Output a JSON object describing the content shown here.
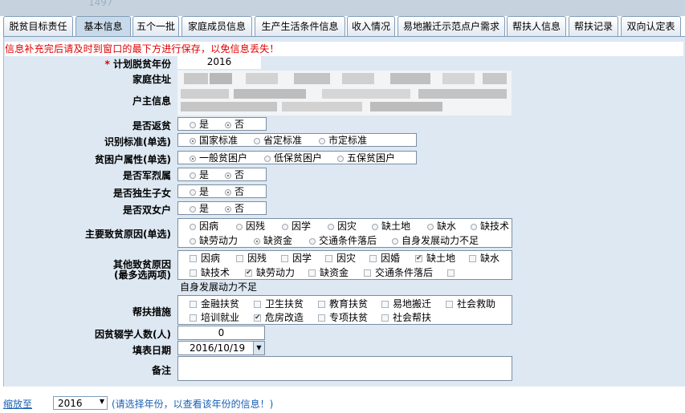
{
  "tabs": [
    {
      "label": "脱贫目标责任"
    },
    {
      "label": "基本信息"
    },
    {
      "label": "五个一批"
    },
    {
      "label": "家庭成员信息"
    },
    {
      "label": "生产生活条件信息"
    },
    {
      "label": "收入情况"
    },
    {
      "label": "易地搬迁示范点户需求"
    },
    {
      "label": "帮扶人信息"
    },
    {
      "label": "帮扶记录"
    },
    {
      "label": "双向认定表"
    }
  ],
  "top_ghost_text": "1497",
  "warning": "信息补充完后请及时到窗口的最下方进行保存，以免信息丢失！",
  "form": {
    "plan_year": {
      "required_mark": "*",
      "label": "计划脱贫年份",
      "value": "2016"
    },
    "address": {
      "label": "家庭住址"
    },
    "householder": {
      "label": "户主信息"
    },
    "return_poverty": {
      "label": "是否返贫",
      "options": [
        "是",
        "否"
      ]
    },
    "standard": {
      "label": "识别标准(单选)",
      "options": [
        "国家标准",
        "省定标准",
        "市定标准"
      ]
    },
    "attribute": {
      "label": "贫困户属性(单选)",
      "options": [
        "一般贫困户",
        "低保贫困户",
        "五保贫困户"
      ]
    },
    "martyr": {
      "label": "是否军烈属",
      "options": [
        "是",
        "否"
      ]
    },
    "only_child": {
      "label": "是否独生子女",
      "options": [
        "是",
        "否"
      ]
    },
    "two_daughters": {
      "label": "是否双女户",
      "options": [
        "是",
        "否"
      ]
    },
    "main_cause": {
      "label": "主要致贫原因(单选)",
      "row1": [
        "因病",
        "因残",
        "因学",
        "因灾",
        "缺土地",
        "缺水",
        "缺技术"
      ],
      "row2": [
        "缺劳动力",
        "缺资金",
        "交通条件落后",
        "自身发展动力不足"
      ]
    },
    "other_cause": {
      "label1": "其他致贫原因",
      "label2": "(最多选两项)",
      "row1": [
        "因病",
        "因残",
        "因学",
        "因灾",
        "因婚",
        "缺土地",
        "缺水"
      ],
      "row2": [
        "缺技术",
        "缺劳动力",
        "缺资金",
        "交通条件落后"
      ],
      "overflow": "自身发展动力不足"
    },
    "measures": {
      "label": "帮扶措施",
      "row1": [
        "金融扶贫",
        "卫生扶贫",
        "教育扶贫",
        "易地搬迁",
        "社会救助"
      ],
      "row2": [
        "培训就业",
        "危房改造",
        "专项扶贫",
        "社会帮扶"
      ]
    },
    "dropout": {
      "label": "因贫辍学人数(人)",
      "value": "0"
    },
    "fill_date": {
      "label": "填表日期",
      "value": "2016/10/19"
    },
    "remarks": {
      "label": "备注",
      "value": ""
    }
  },
  "footer": {
    "zoom_link": "缩放至",
    "year_value": "2016",
    "hint": "(请选择年份，以查看该年份的信息！)"
  },
  "colors": {
    "accent": "#1a5fb4",
    "warning": "#e00000",
    "panel": "#dde8f2"
  }
}
